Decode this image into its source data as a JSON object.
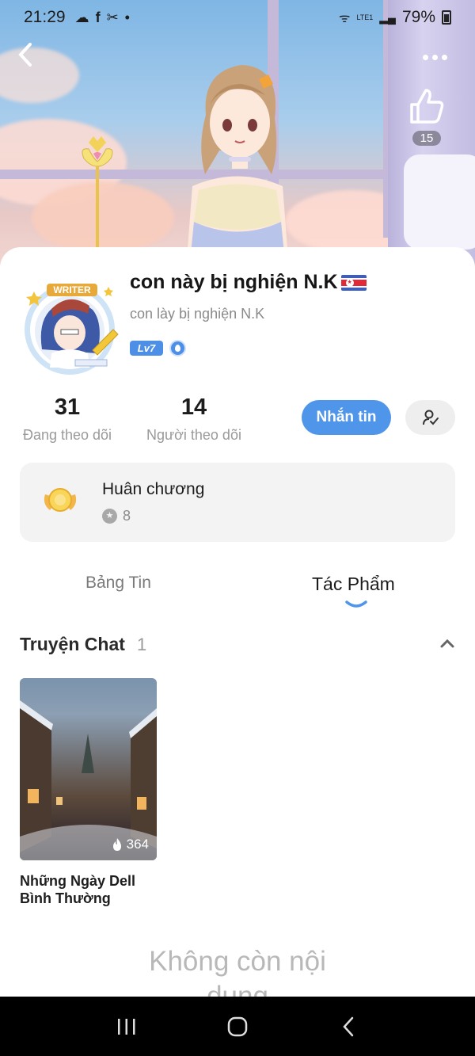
{
  "status_bar": {
    "time": "21:29",
    "battery": "79%",
    "network": "LTE1"
  },
  "header": {
    "like_count": "15"
  },
  "profile": {
    "display_name": "con này bị nghiện N.K",
    "username": "con lày bị nghiện N.K",
    "level": "Lv7",
    "avatar_badge": "WRITER"
  },
  "stats": {
    "following_count": "31",
    "following_label": "Đang theo dõi",
    "followers_count": "14",
    "followers_label": "Người theo dõi"
  },
  "actions": {
    "message_label": "Nhắn tin"
  },
  "medals": {
    "title": "Huân chương",
    "count": "8"
  },
  "tabs": [
    {
      "label": "Bảng Tin",
      "active": false
    },
    {
      "label": "Tác Phẩm",
      "active": true
    }
  ],
  "section": {
    "title": "Truyện Chat",
    "count": "1"
  },
  "stories": [
    {
      "title": "Những Ngày Dell Bình Thường",
      "views": "364"
    }
  ],
  "end_message": "Không còn nội dung",
  "colors": {
    "accent": "#4f95ea",
    "level_badge": "#4d8fe6"
  }
}
